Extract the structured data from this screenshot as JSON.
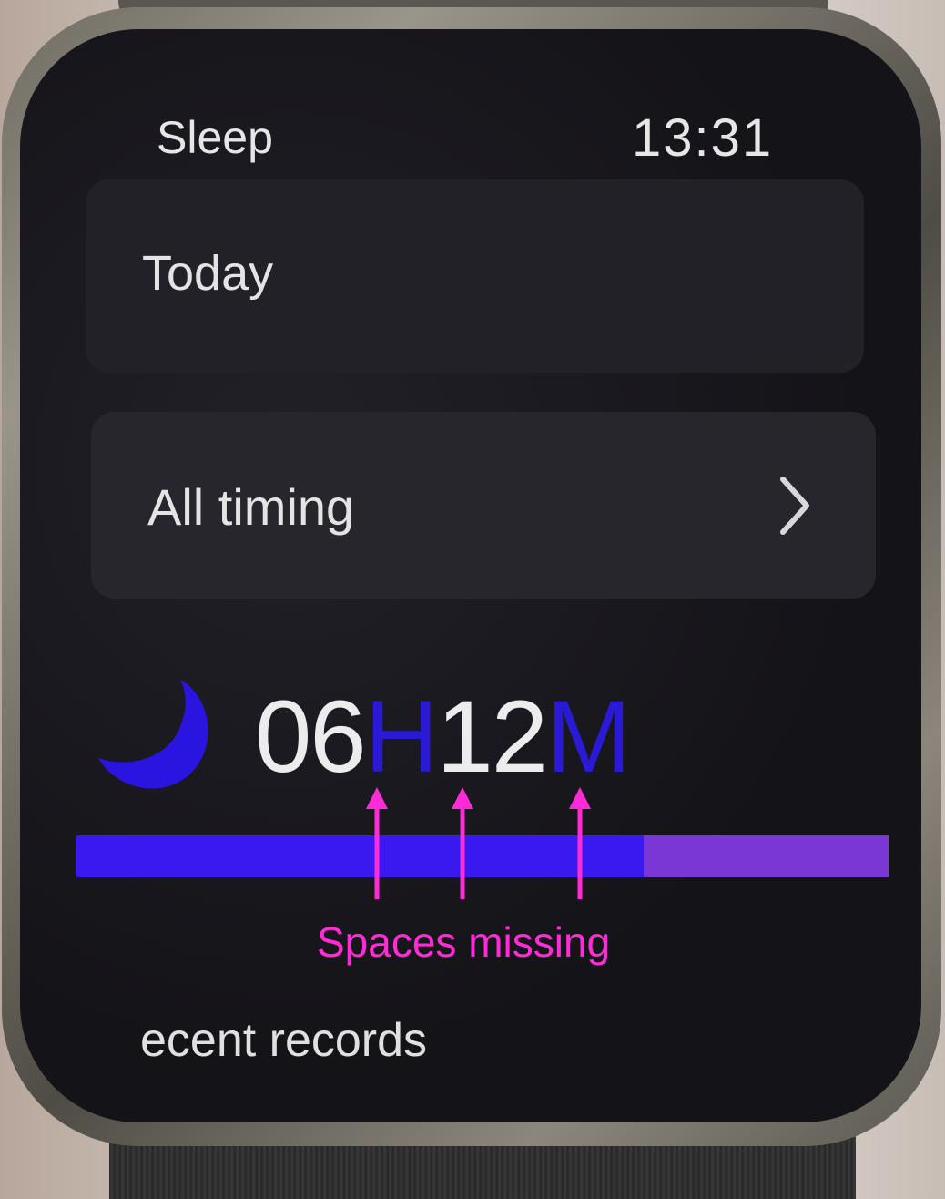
{
  "status": {
    "title": "Sleep",
    "time": "13:31"
  },
  "cards": {
    "today_label": "Today",
    "timing_label": "All timing"
  },
  "duration": {
    "hours": "06",
    "hours_unit": "H",
    "minutes": "12",
    "minutes_unit": "M"
  },
  "sleep_bar": {
    "deep_fraction": 0.698,
    "light_fraction": 0.302,
    "colors": {
      "deep": "#3a18f0",
      "light": "#7a37d6"
    }
  },
  "annotation": {
    "label": "Spaces missing",
    "color": "#ff2bd6"
  },
  "recent": {
    "label": "ecent records"
  },
  "icons": {
    "moon": "moon-icon",
    "chevron": "chevron-right-icon"
  }
}
